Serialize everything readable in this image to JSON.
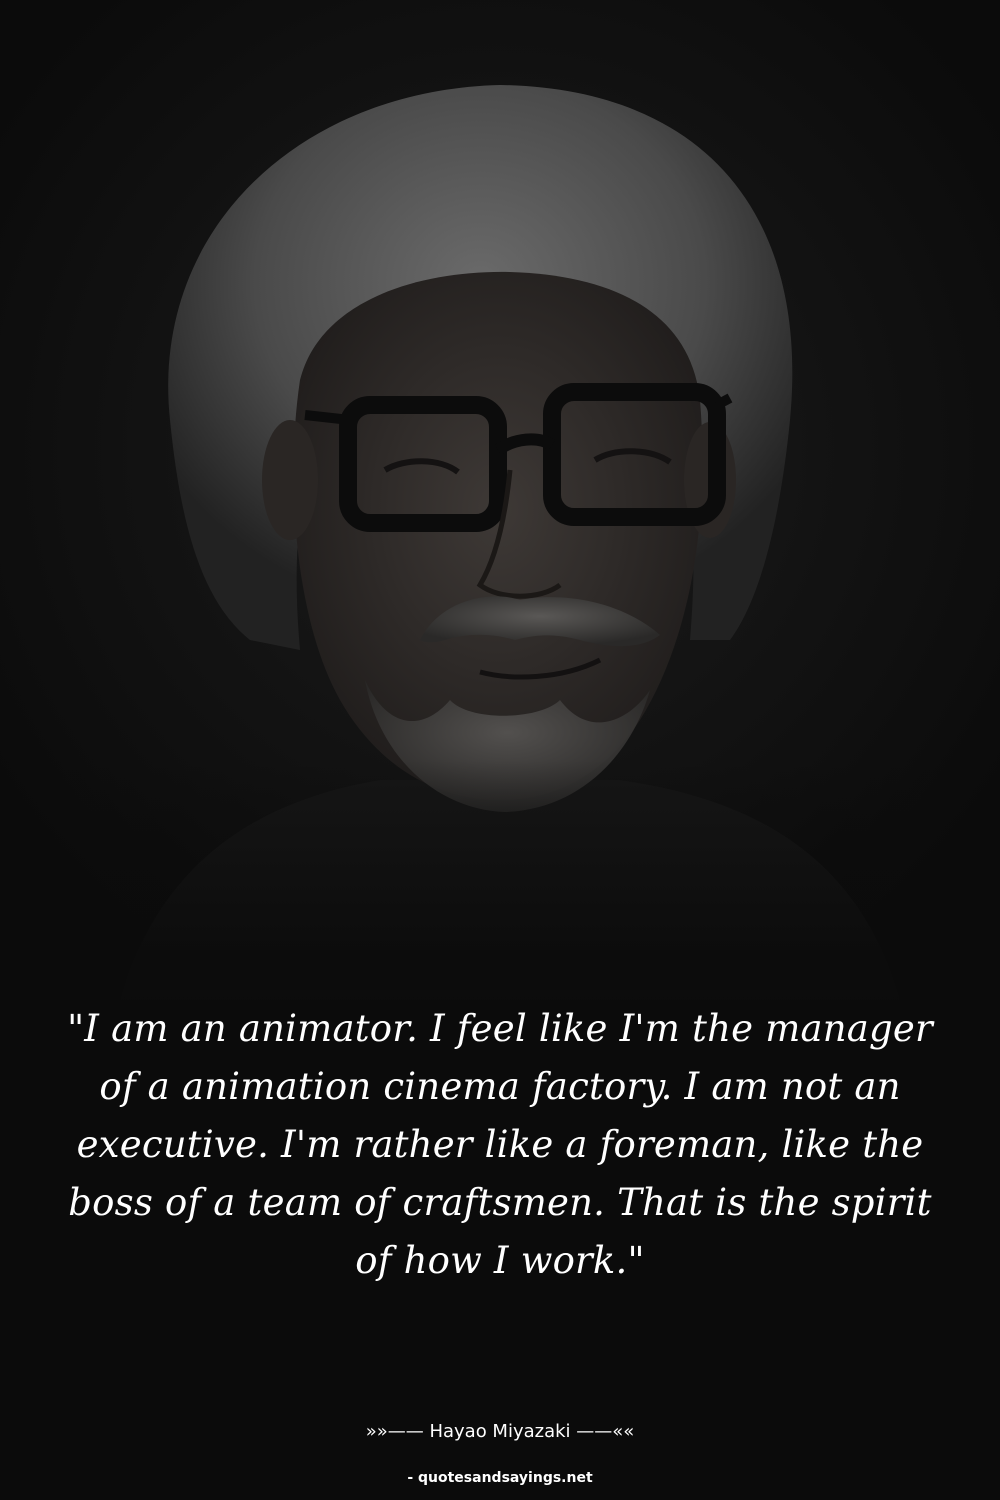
{
  "image": {
    "subject": "portrait-photo",
    "background_color": "#0b0b0b"
  },
  "quote": {
    "text": "\"I am an animator. I feel like I'm the manager of a animation cinema factory. I am not an executive. I'm rather like a foreman, like the boss of a team of craftsmen. That is the spirit of how I work.\""
  },
  "attribution": {
    "author_line": "»»—— Hayao Miyazaki ——««",
    "source_line": "- quotesandsayings.net"
  }
}
